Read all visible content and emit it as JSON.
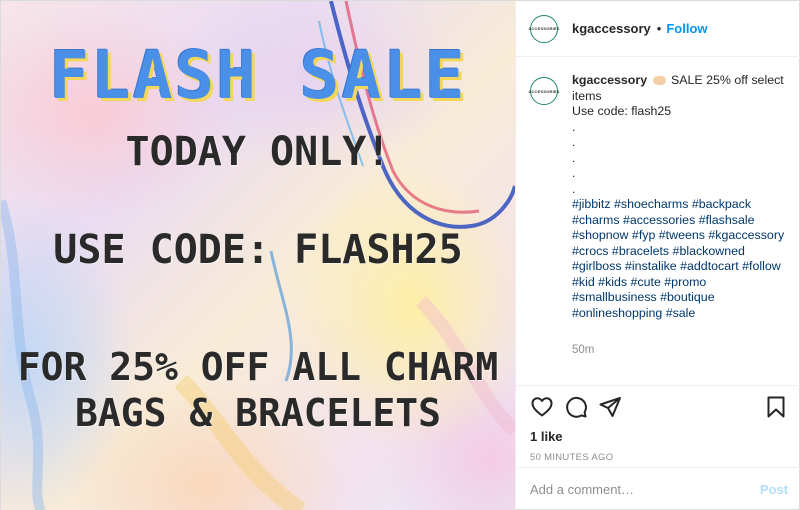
{
  "image": {
    "headline": "FLASH SALE",
    "line1": "TODAY ONLY!",
    "line2": "USE CODE: FLASH25",
    "line3": "FOR 25% OFF ALL CHARM",
    "line4": "BAGS & BRACELETS"
  },
  "header": {
    "avatar_text": "ACCESSORIES",
    "username": "kgaccessory",
    "separator": "•",
    "follow_label": "Follow"
  },
  "caption": {
    "username": "kgaccessory",
    "emoji": "hand-pointing-emoji",
    "text_line1": "SALE 25% off select items",
    "text_line2": "Use code: flash25",
    "dots": [
      ".",
      ".",
      ".",
      ".",
      "."
    ],
    "hashtags": "#jibbitz #shoecharms #backpack #charms #accessories #flashsale #shopnow #fyp #tweens #kgaccessory #crocs #bracelets #blackowned #girlboss #instalike #addtocart #follow #kid #kids #cute #promo #smallbusiness #boutique #onlineshopping #sale",
    "time": "50m"
  },
  "actions": {
    "icons": [
      "heart-icon",
      "comment-icon",
      "share-icon",
      "bookmark-icon"
    ],
    "likes": "1 like",
    "posted_ago": "50 MINUTES AGO"
  },
  "comment": {
    "placeholder": "Add a comment…",
    "post_label": "Post"
  },
  "colors": {
    "link": "#0095f6",
    "hashtag": "#00376b",
    "headline": "#4a8fe8",
    "post_disabled": "#b2dffc"
  }
}
